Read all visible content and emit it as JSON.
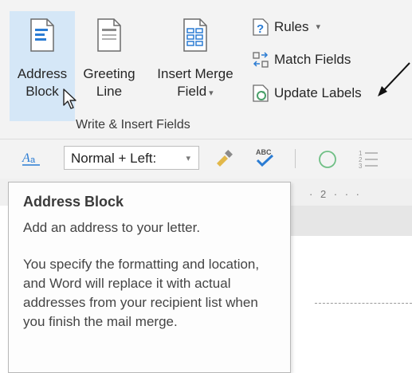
{
  "ribbon": {
    "address_block": {
      "line1": "Address",
      "line2": "Block"
    },
    "greeting_line": {
      "line1": "Greeting",
      "line2": "Line"
    },
    "insert_merge_field": {
      "line1": "Insert Merge",
      "line2": "Field"
    },
    "rules_label": "Rules",
    "match_fields_label": "Match Fields",
    "update_labels_label": "Update Labels",
    "group_label": "Write & Insert Fields"
  },
  "toolbar": {
    "style_value": "Normal + Left:"
  },
  "ruler": {
    "text": "· 2 · · ·"
  },
  "tooltip": {
    "title": "Address Block",
    "summary": "Add an address to your letter.",
    "body": "You specify the formatting and location, and Word will replace it with actual addresses from your recipient list when you finish the mail merge."
  },
  "icons": {
    "address": "address-block-icon",
    "greeting": "greeting-line-icon",
    "merge": "insert-merge-field-icon",
    "rules": "rules-icon",
    "match": "match-fields-icon",
    "update": "update-labels-icon"
  },
  "colors": {
    "accent": "#2b7cd3",
    "hover": "#d5e7f7",
    "green": "#5aa86a"
  }
}
